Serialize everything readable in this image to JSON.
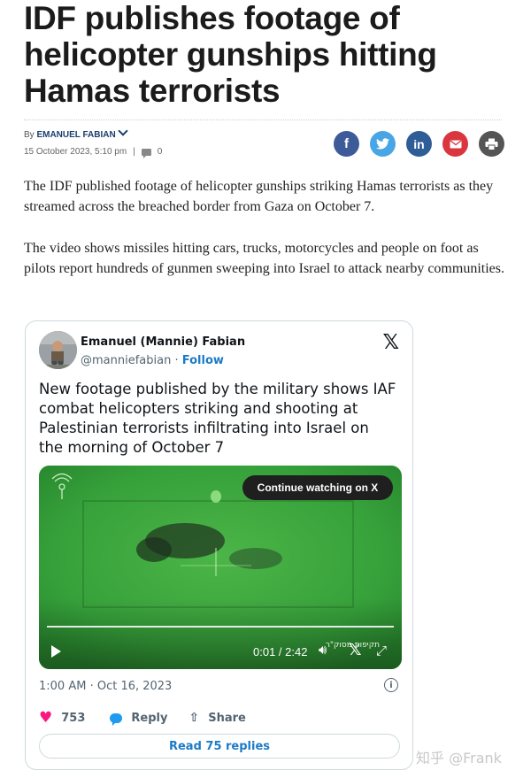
{
  "article": {
    "headline": "IDF publishes footage of helicopter gunships hitting Hamas terrorists",
    "by_prefix": "By ",
    "author": "EMANUEL FABIAN",
    "date": "15 October 2023, 5:10 pm",
    "meta_separator": "|",
    "comments_count": "0",
    "share_icons": [
      "facebook-icon",
      "twitter-icon",
      "linkedin-icon",
      "email-icon",
      "print-icon"
    ],
    "paragraph1": "The IDF published footage of helicopter gunships striking Hamas terrorists as they streamed across the breached border from Gaza on October 7.",
    "paragraph2": "The video shows missiles hitting cars, trucks, motorcycles and people on foot as pilots report hundreds of gunmen sweeping into Israel to attack nearby communities."
  },
  "tweet": {
    "name": "Emanuel (Mannie) Fabian",
    "handle": "@manniefabian",
    "separator": " · ",
    "follow": "Follow",
    "text": "New footage published by the military shows IAF combat helicopters striking and shooting at Palestinian terrorists infiltrating into Israel on the morning of October 7",
    "video": {
      "continue_label": "Continue watching on X",
      "time": "0:01 / 2:42",
      "progress": 0.006,
      "overlay_text": "תקיפות מסוק\"ר"
    },
    "timestamp": "1:00 AM · Oct 16, 2023",
    "likes": "753",
    "reply_label": "Reply",
    "share_label": "Share",
    "read_replies": "Read 75 replies"
  },
  "watermark": "知乎 @Frank",
  "colors": {
    "author_link": "#1a3e6e",
    "follow_link": "#1d7bc6",
    "heart": "#f91880",
    "video_green": "#37a33c"
  }
}
